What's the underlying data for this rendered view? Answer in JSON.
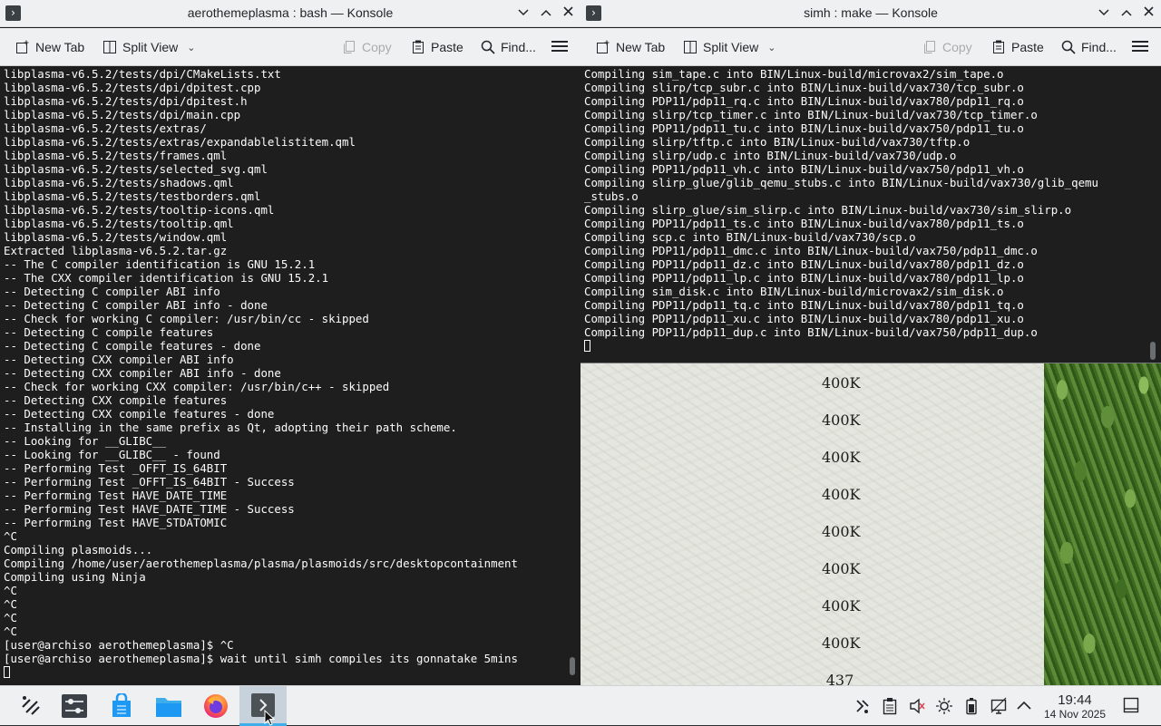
{
  "desktop": {
    "size_labels": [
      "400K",
      "400K",
      "400K",
      "400K",
      "400K",
      "400K",
      "400K",
      "400K",
      "437"
    ]
  },
  "left_window": {
    "title": "aerothemeplasma : bash — Konsole",
    "toolbar": {
      "new_tab": "New Tab",
      "split_view": "Split View",
      "copy": "Copy",
      "paste": "Paste",
      "find": "Find..."
    },
    "lines": [
      "libplasma-v6.5.2/tests/dpi/CMakeLists.txt",
      "libplasma-v6.5.2/tests/dpi/dpitest.cpp",
      "libplasma-v6.5.2/tests/dpi/dpitest.h",
      "libplasma-v6.5.2/tests/dpi/main.cpp",
      "libplasma-v6.5.2/tests/extras/",
      "libplasma-v6.5.2/tests/extras/expandablelistitem.qml",
      "libplasma-v6.5.2/tests/frames.qml",
      "libplasma-v6.5.2/tests/selected_svg.qml",
      "libplasma-v6.5.2/tests/shadows.qml",
      "libplasma-v6.5.2/tests/testborders.qml",
      "libplasma-v6.5.2/tests/tooltip-icons.qml",
      "libplasma-v6.5.2/tests/tooltip.qml",
      "libplasma-v6.5.2/tests/window.qml",
      "Extracted libplasma-v6.5.2.tar.gz",
      "-- The C compiler identification is GNU 15.2.1",
      "-- The CXX compiler identification is GNU 15.2.1",
      "-- Detecting C compiler ABI info",
      "-- Detecting C compiler ABI info - done",
      "-- Check for working C compiler: /usr/bin/cc - skipped",
      "-- Detecting C compile features",
      "-- Detecting C compile features - done",
      "-- Detecting CXX compiler ABI info",
      "-- Detecting CXX compiler ABI info - done",
      "-- Check for working CXX compiler: /usr/bin/c++ - skipped",
      "-- Detecting CXX compile features",
      "-- Detecting CXX compile features - done",
      "-- Installing in the same prefix as Qt, adopting their path scheme.",
      "-- Looking for __GLIBC__",
      "-- Looking for __GLIBC__ - found",
      "-- Performing Test _OFFT_IS_64BIT",
      "-- Performing Test _OFFT_IS_64BIT - Success",
      "-- Performing Test HAVE_DATE_TIME",
      "-- Performing Test HAVE_DATE_TIME - Success",
      "-- Performing Test HAVE_STDATOMIC",
      "^C",
      "Compiling plasmoids...",
      "Compiling /home/user/aerothemeplasma/plasma/plasmoids/src/desktopcontainment",
      "Compiling using Ninja",
      "^C",
      "^C",
      "^C",
      "^C",
      "[user@archiso aerothemeplasma]$ ^C",
      "[user@archiso aerothemeplasma]$ wait until simh compiles its gonnatake 5mins"
    ]
  },
  "right_window": {
    "title": "simh : make — Konsole",
    "toolbar": {
      "new_tab": "New Tab",
      "split_view": "Split View",
      "copy": "Copy",
      "paste": "Paste",
      "find": "Find..."
    },
    "lines": [
      "Compiling sim_tape.c into BIN/Linux-build/microvax2/sim_tape.o",
      "Compiling slirp/tcp_subr.c into BIN/Linux-build/vax730/tcp_subr.o",
      "Compiling PDP11/pdp11_rq.c into BIN/Linux-build/vax780/pdp11_rq.o",
      "Compiling slirp/tcp_timer.c into BIN/Linux-build/vax730/tcp_timer.o",
      "Compiling PDP11/pdp11_tu.c into BIN/Linux-build/vax750/pdp11_tu.o",
      "Compiling slirp/tftp.c into BIN/Linux-build/vax730/tftp.o",
      "Compiling slirp/udp.c into BIN/Linux-build/vax730/udp.o",
      "Compiling PDP11/pdp11_vh.c into BIN/Linux-build/vax750/pdp11_vh.o",
      "Compiling slirp_glue/glib_qemu_stubs.c into BIN/Linux-build/vax730/glib_qemu",
      "_stubs.o",
      "Compiling slirp_glue/sim_slirp.c into BIN/Linux-build/vax730/sim_slirp.o",
      "Compiling PDP11/pdp11_ts.c into BIN/Linux-build/vax780/pdp11_ts.o",
      "Compiling scp.c into BIN/Linux-build/vax730/scp.o",
      "Compiling PDP11/pdp11_dmc.c into BIN/Linux-build/vax750/pdp11_dmc.o",
      "Compiling PDP11/pdp11_dz.c into BIN/Linux-build/vax780/pdp11_dz.o",
      "Compiling PDP11/pdp11_lp.c into BIN/Linux-build/vax780/pdp11_lp.o",
      "Compiling sim_disk.c into BIN/Linux-build/microvax2/sim_disk.o",
      "Compiling PDP11/pdp11_tq.c into BIN/Linux-build/vax780/pdp11_tq.o",
      "Compiling PDP11/pdp11_xu.c into BIN/Linux-build/vax780/pdp11_xu.o",
      "Compiling PDP11/pdp11_dup.c into BIN/Linux-build/vax750/pdp11_dup.o"
    ]
  },
  "taskbar": {
    "apps": [
      "app-launcher-icon",
      "system-settings-icon",
      "discover-icon",
      "file-manager-icon",
      "firefox-icon",
      "konsole-icon"
    ],
    "tray": [
      "kde-connect-icon",
      "clipboard-icon",
      "volume-muted-icon",
      "brightness-icon",
      "battery-icon",
      "network-icon",
      "expand-tray-icon"
    ],
    "clock_time": "19:44",
    "clock_date": "14 Nov 2025"
  }
}
